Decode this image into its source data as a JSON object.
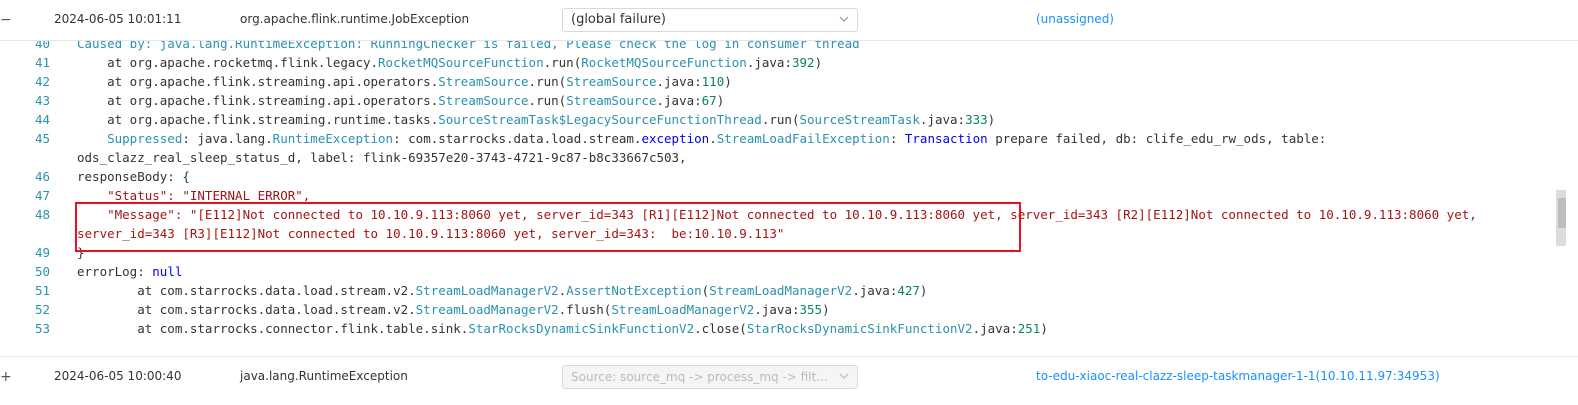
{
  "rows": [
    {
      "expand": "−",
      "time": "2024-06-05 10:01:11",
      "exception": "org.apache.flink.runtime.JobException",
      "task": "(global failure)",
      "taskmanager": "(unassigned)"
    },
    {
      "expand": "+",
      "time": "2024-06-05 10:00:40",
      "exception": "java.lang.RuntimeException",
      "task": "Source: source_mq -> process_mq -> filt...",
      "taskmanager": "to-edu-xiaoc-real-clazz-sleep-taskmanager-1-1(10.10.11.97:34953)"
    }
  ],
  "code": {
    "lines": [
      {
        "n": "40",
        "parts": [
          {
            "t": "Caused by: java.lang.RuntimeException: RunningChecker is failed, Please check the log in consumer thread",
            "c": "c-teal"
          }
        ]
      },
      {
        "n": "41",
        "parts": [
          {
            "t": "    at org.apache.rocketmq.flink.legacy.",
            "c": ""
          },
          {
            "t": "RocketMQSourceFunction",
            "c": "c-teal"
          },
          {
            "t": ".run(",
            "c": ""
          },
          {
            "t": "RocketMQSourceFunction",
            "c": "c-teal"
          },
          {
            "t": ".java:",
            "c": ""
          },
          {
            "t": "392",
            "c": "c-num"
          },
          {
            "t": ")",
            "c": ""
          }
        ]
      },
      {
        "n": "42",
        "parts": [
          {
            "t": "    at org.apache.flink.streaming.api.operators.",
            "c": ""
          },
          {
            "t": "StreamSource",
            "c": "c-teal"
          },
          {
            "t": ".run(",
            "c": ""
          },
          {
            "t": "StreamSource",
            "c": "c-teal"
          },
          {
            "t": ".java:",
            "c": ""
          },
          {
            "t": "110",
            "c": "c-num"
          },
          {
            "t": ")",
            "c": ""
          }
        ]
      },
      {
        "n": "43",
        "parts": [
          {
            "t": "    at org.apache.flink.streaming.api.operators.",
            "c": ""
          },
          {
            "t": "StreamSource",
            "c": "c-teal"
          },
          {
            "t": ".run(",
            "c": ""
          },
          {
            "t": "StreamSource",
            "c": "c-teal"
          },
          {
            "t": ".java:",
            "c": ""
          },
          {
            "t": "67",
            "c": "c-num"
          },
          {
            "t": ")",
            "c": ""
          }
        ]
      },
      {
        "n": "44",
        "parts": [
          {
            "t": "    at org.apache.flink.streaming.runtime.tasks.",
            "c": ""
          },
          {
            "t": "SourceStreamTask$LegacySourceFunctionThread",
            "c": "c-teal"
          },
          {
            "t": ".run(",
            "c": ""
          },
          {
            "t": "SourceStreamTask",
            "c": "c-teal"
          },
          {
            "t": ".java:",
            "c": ""
          },
          {
            "t": "333",
            "c": "c-num"
          },
          {
            "t": ")",
            "c": ""
          }
        ]
      },
      {
        "n": "45",
        "parts": [
          {
            "t": "    Suppressed",
            "c": "c-teal"
          },
          {
            "t": ": java.lang.",
            "c": ""
          },
          {
            "t": "RuntimeException",
            "c": "c-teal"
          },
          {
            "t": ": com.starrocks.data.load.stream.",
            "c": ""
          },
          {
            "t": "exception",
            "c": "c-blue"
          },
          {
            "t": ".",
            "c": ""
          },
          {
            "t": "StreamLoadFailException",
            "c": "c-teal"
          },
          {
            "t": ": ",
            "c": ""
          },
          {
            "t": "Transaction",
            "c": "c-blue"
          },
          {
            "t": " prepare failed, db: clife_edu_rw_ods, table:",
            "c": ""
          }
        ]
      },
      {
        "n": "",
        "parts": [
          {
            "t": "ods_clazz_real_sleep_status_d, label: flink-69357e20-3743-4721-9c87-b8c33667c503,",
            "c": ""
          }
        ]
      },
      {
        "n": "46",
        "parts": [
          {
            "t": "responseBody: {",
            "c": ""
          }
        ]
      },
      {
        "n": "47",
        "parts": [
          {
            "t": "    \"Status\": \"INTERNAL_ERROR\",",
            "c": "c-red"
          }
        ]
      },
      {
        "n": "48",
        "parts": [
          {
            "t": "    \"Message\": \"[E112]Not connected to 10.10.9.113:8060 yet, server_id=343 [R1][E112]Not connected to 10.10.9.113:8060 yet, server_id=343 [R2][E112]Not connected to 10.10.9.113:8060 yet,",
            "c": "c-red"
          }
        ]
      },
      {
        "n": "",
        "parts": [
          {
            "t": "server_id=343 [R3][E112]Not connected to 10.10.9.113:8060 yet, server_id=343:  be:10.10.9.113\"",
            "c": "c-red"
          }
        ]
      },
      {
        "n": "49",
        "parts": [
          {
            "t": "}",
            "c": ""
          }
        ]
      },
      {
        "n": "50",
        "parts": [
          {
            "t": "errorLog: ",
            "c": ""
          },
          {
            "t": "null",
            "c": "c-blue"
          }
        ]
      },
      {
        "n": "51",
        "parts": [
          {
            "t": "        at com.starrocks.data.load.stream.v2.",
            "c": ""
          },
          {
            "t": "StreamLoadManagerV2",
            "c": "c-teal"
          },
          {
            "t": ".",
            "c": ""
          },
          {
            "t": "AssertNotException",
            "c": "c-teal"
          },
          {
            "t": "(",
            "c": ""
          },
          {
            "t": "StreamLoadManagerV2",
            "c": "c-teal"
          },
          {
            "t": ".java:",
            "c": ""
          },
          {
            "t": "427",
            "c": "c-num"
          },
          {
            "t": ")",
            "c": ""
          }
        ]
      },
      {
        "n": "52",
        "parts": [
          {
            "t": "        at com.starrocks.data.load.stream.v2.",
            "c": ""
          },
          {
            "t": "StreamLoadManagerV2",
            "c": "c-teal"
          },
          {
            "t": ".flush(",
            "c": ""
          },
          {
            "t": "StreamLoadManagerV2",
            "c": "c-teal"
          },
          {
            "t": ".java:",
            "c": ""
          },
          {
            "t": "355",
            "c": "c-num"
          },
          {
            "t": ")",
            "c": ""
          }
        ]
      },
      {
        "n": "53",
        "parts": [
          {
            "t": "        at com.starrocks.connector.flink.table.sink.",
            "c": ""
          },
          {
            "t": "StarRocksDynamicSinkFunctionV2",
            "c": "c-teal"
          },
          {
            "t": ".close(",
            "c": ""
          },
          {
            "t": "StarRocksDynamicSinkFunctionV2",
            "c": "c-teal"
          },
          {
            "t": ".java:",
            "c": ""
          },
          {
            "t": "251",
            "c": "c-num"
          },
          {
            "t": ")",
            "c": ""
          }
        ]
      }
    ]
  }
}
